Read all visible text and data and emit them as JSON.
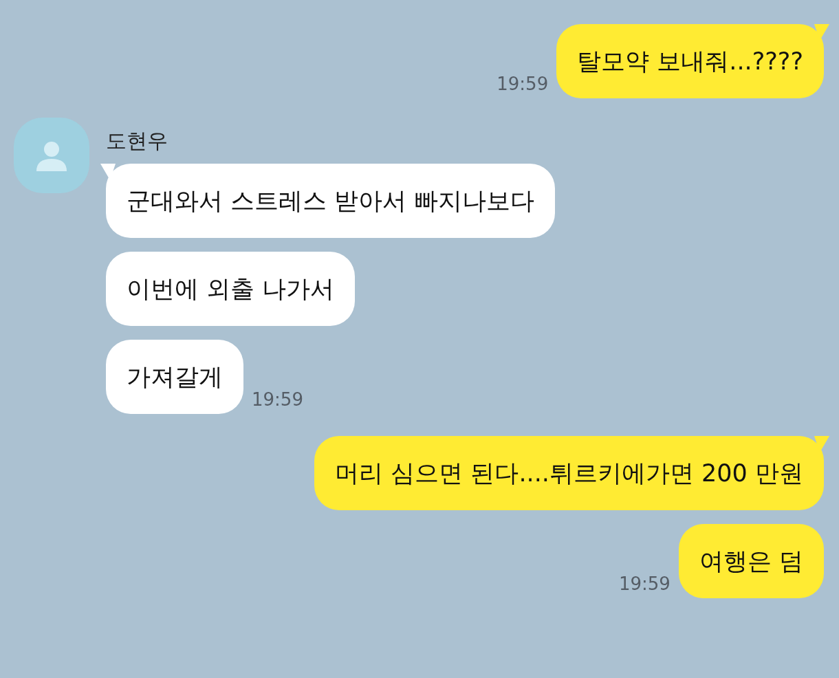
{
  "messages": [
    {
      "kind": "sent",
      "bubbles": [
        "탈모약 보내줘...????"
      ],
      "time": "19:59"
    },
    {
      "kind": "received",
      "sender": "도현우",
      "bubbles": [
        "군대와서 스트레스 받아서 빠지나보다",
        "이번에 외출 나가서",
        "가져갈게"
      ],
      "time": "19:59"
    },
    {
      "kind": "sent",
      "bubbles": [
        "머리 심으면 된다....튀르키에가면 200 만원",
        "여행은 덤"
      ],
      "time": "19:59"
    }
  ]
}
